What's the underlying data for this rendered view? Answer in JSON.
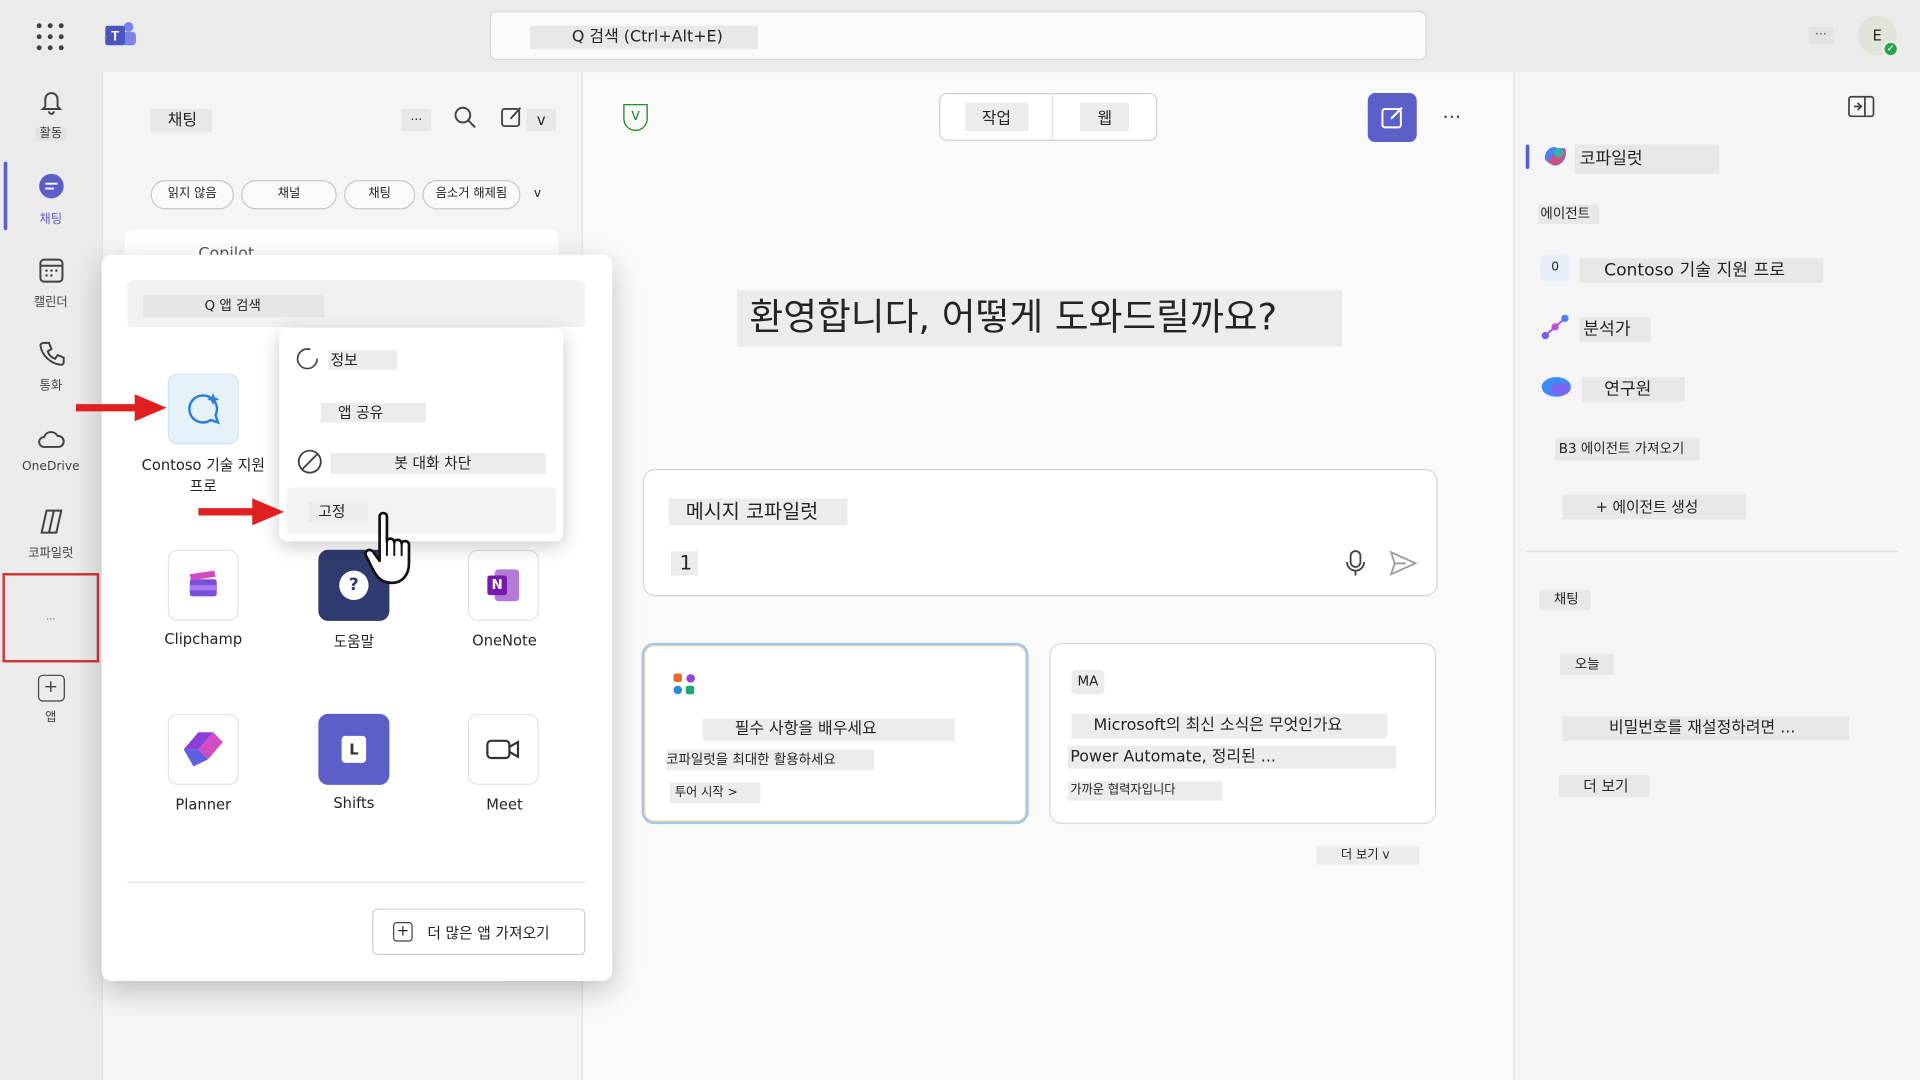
{
  "topbar": {
    "search_label": "Q 검색 (Ctrl+Alt+E)",
    "more_label": "...",
    "avatar_initial": "E",
    "presence_glyph": "✓"
  },
  "rail": {
    "items": [
      {
        "label": "활동",
        "icon": "bell-icon"
      },
      {
        "label": "채팅",
        "icon": "chat-icon"
      },
      {
        "label": "캘린더",
        "icon": "calendar-icon"
      },
      {
        "label": "통화",
        "icon": "phone-icon"
      },
      {
        "label": "OneDrive",
        "icon": "cloud-icon"
      },
      {
        "label": "코파일럿",
        "icon": "copilot-icon"
      },
      {
        "label": "...",
        "icon": "more-icon"
      },
      {
        "label": "앱",
        "icon": "add-app-icon"
      }
    ],
    "add_glyph": "+"
  },
  "chatlist": {
    "title": "채팅",
    "more": "...",
    "compose_chevron": "v",
    "filters": [
      "읽지 않음",
      "채널",
      "채팅",
      "음소거 해제됨"
    ],
    "filter_chevron": "v",
    "partial_item": "Copilot"
  },
  "flyout": {
    "search_label": "Q 앱 검색",
    "apps": [
      {
        "label": "Contoso 기술 지원 프로",
        "icon": "contoso-bot-icon"
      },
      {
        "label": "Clipchamp",
        "icon": "clipchamp-icon"
      },
      {
        "label": "도움말",
        "icon": "help-icon"
      },
      {
        "label": "OneNote",
        "icon": "onenote-icon"
      },
      {
        "label": "Planner",
        "icon": "planner-icon"
      },
      {
        "label": "Shifts",
        "icon": "shifts-icon"
      },
      {
        "label": "Meet",
        "icon": "meet-icon"
      }
    ],
    "help_glyph": "?",
    "onenote_glyph": "N",
    "shifts_glyph": "L",
    "get_more_label": "더 많은 앱 가져오기",
    "get_more_glyph": "+"
  },
  "context_menu": {
    "items": [
      "정보",
      "앱 공유",
      "봇 대화 차단",
      "고정"
    ]
  },
  "main": {
    "badge_glyph": "V",
    "tabs": [
      "작업",
      "웹"
    ],
    "more": "···",
    "greeting": "환영합니다, 어떻게 도와드릴까요?",
    "composer_placeholder": "메시지 코파일럿",
    "composer_value": "1",
    "cards": [
      {
        "title": "필수 사항을 배우세요",
        "subtitle": "코파일럿을 최대한 활용하세요",
        "action": "투어 시작 >"
      },
      {
        "badge": "MA",
        "title": "Microsoft의 최신 소식은 무엇인가요",
        "subtitle": "Power Automate, 정리된 ...",
        "action": "가까운 협력자입니다"
      }
    ],
    "see_more": "더 보기 v"
  },
  "rpanel": {
    "title": "코파일럿",
    "agents_header": "에이전트",
    "agents": [
      {
        "label": "Contoso 기술 지원 프로",
        "badge": "0"
      },
      {
        "label": "분석가"
      },
      {
        "label": "연구원"
      }
    ],
    "get_agents": "B3 에이전트 가져오기",
    "create_agent": "+ 에이전트 생성",
    "chats_header": "채팅",
    "today": "오늘",
    "recent_chat": "비밀번호를 재설정하려면 ...",
    "see_more": "더 보기"
  }
}
